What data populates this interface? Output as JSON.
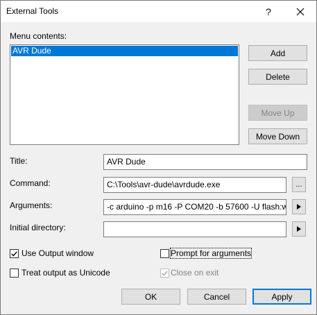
{
  "window": {
    "title": "External Tools"
  },
  "menu_contents": {
    "label": "Menu contents:",
    "items": [
      "AVR Dude"
    ]
  },
  "side_buttons": {
    "add": "Add",
    "delete": "Delete",
    "move_up": "Move Up",
    "move_down": "Move Down"
  },
  "fields": {
    "title_label": "Title:",
    "title_value": "AVR Dude",
    "command_label": "Command:",
    "command_value": "C:\\Tools\\avr-dude\\avrdude.exe",
    "browse_label": "...",
    "arguments_label": "Arguments:",
    "arguments_value": "-c arduino -p m16 -P COM20 -b 57600 -U flash:w",
    "initial_dir_label": "Initial directory:",
    "initial_dir_value": ""
  },
  "options": {
    "use_output_window": {
      "label": "Use Output window",
      "checked": true
    },
    "treat_unicode": {
      "label": "Treat output as Unicode",
      "checked": false
    },
    "prompt_args": {
      "label": "Prompt for arguments",
      "checked": false
    },
    "close_on_exit": {
      "label": "Close on exit",
      "checked": true,
      "disabled": true
    }
  },
  "footer": {
    "ok": "OK",
    "cancel": "Cancel",
    "apply": "Apply"
  },
  "colors": {
    "selection": "#0078d7",
    "dialog_bg": "#f0f0f0"
  }
}
